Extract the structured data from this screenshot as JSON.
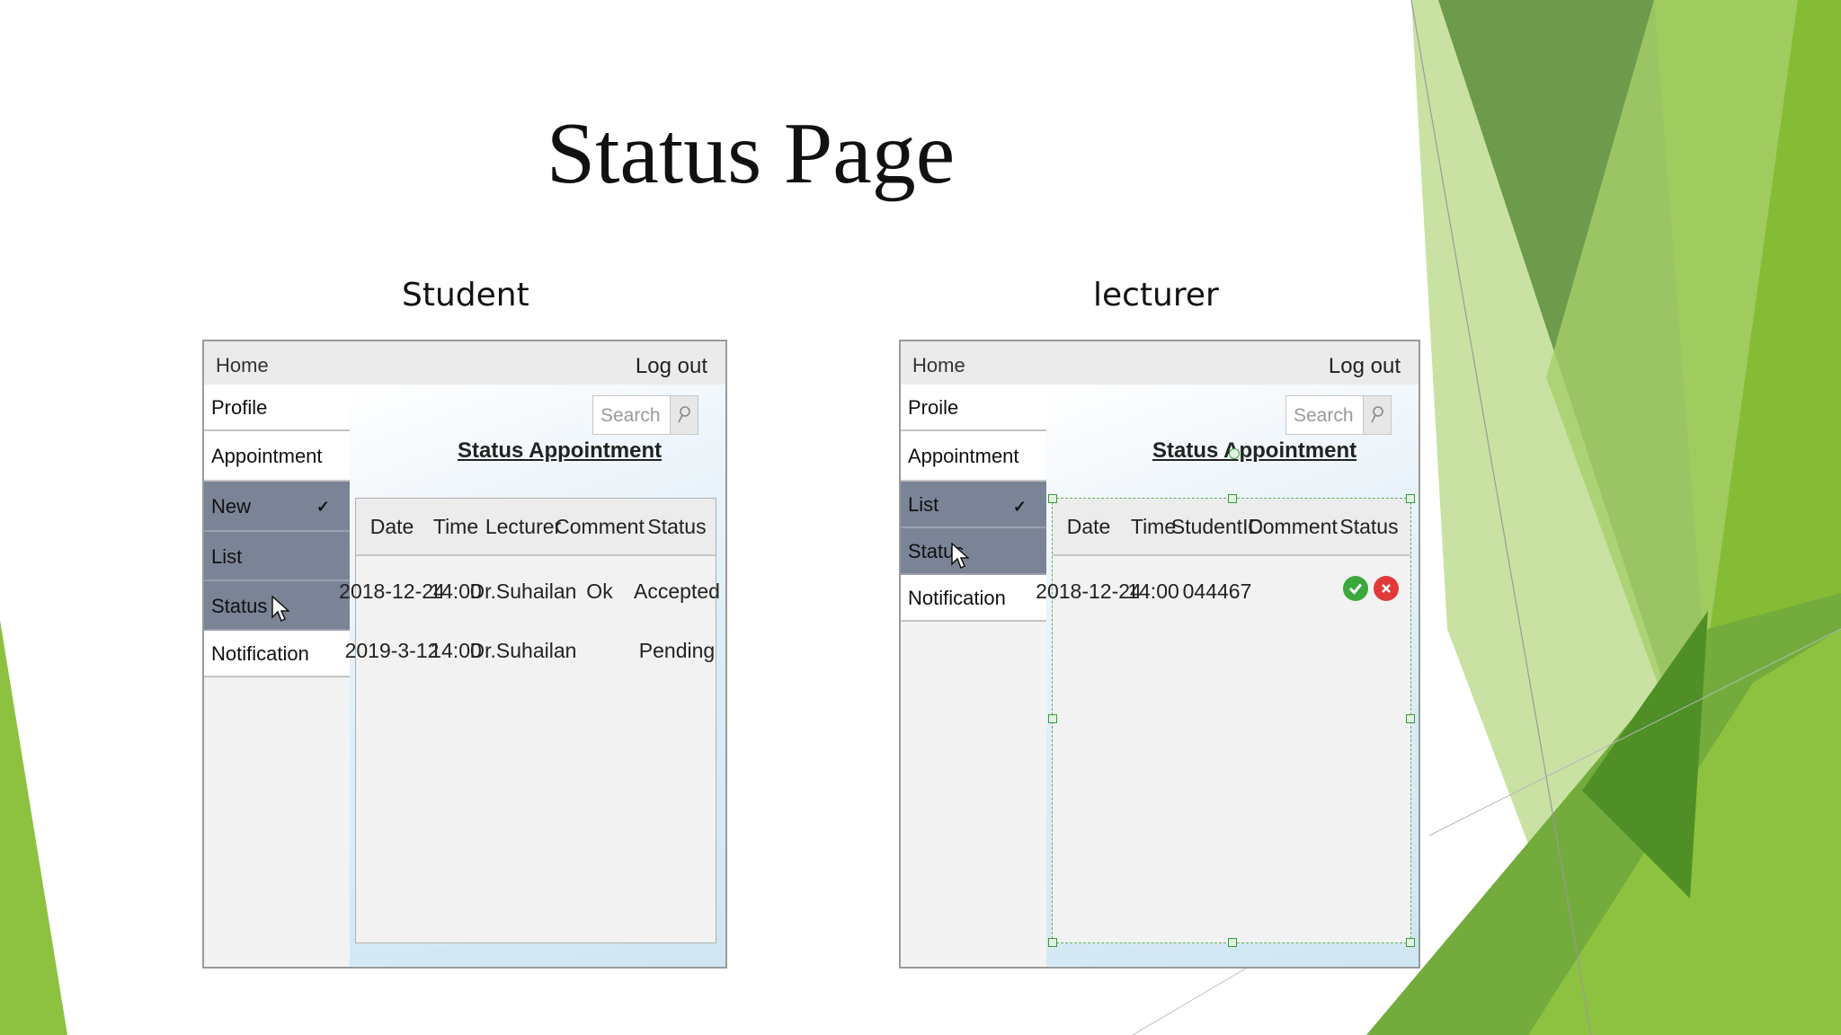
{
  "slide": {
    "title": "Status Page"
  },
  "panels": [
    {
      "caption": "Student",
      "nav": {
        "home": "Home",
        "logout": "Log out"
      },
      "sidebar": [
        "Profile",
        "Appointment",
        "New",
        "List",
        "Status",
        "Notification"
      ],
      "search_placeholder": "Search",
      "heading": "Status Appointment",
      "columns": [
        "Date",
        "Time",
        "Lecturer",
        "Comment",
        "Status"
      ],
      "rows": [
        [
          "2018-12-24",
          "14:00",
          "Dr.Suhailan",
          "Ok",
          "Accepted"
        ],
        [
          "2019-3-12",
          "14:00",
          "Dr.Suhailan",
          "",
          "Pending"
        ]
      ]
    },
    {
      "caption": "lecturer",
      "nav": {
        "home": "Home",
        "logout": "Log out"
      },
      "sidebar": [
        "Proile",
        "Appointment",
        "List",
        "Status",
        "Notification"
      ],
      "search_placeholder": "Search",
      "heading": "Status Appointment",
      "columns": [
        "Date",
        "Time",
        "StudentID",
        "Comment",
        "Status"
      ],
      "rows": [
        [
          "2018-12-24",
          "14:00",
          "044467",
          "",
          ""
        ]
      ]
    }
  ],
  "colors": {
    "menu_selected": "#7b8497",
    "accept": "#3aa83a",
    "reject": "#e03a3a",
    "green_dark": "#5f9a3a",
    "green_mid": "#7fb63a",
    "green_light": "#c5e09b"
  }
}
